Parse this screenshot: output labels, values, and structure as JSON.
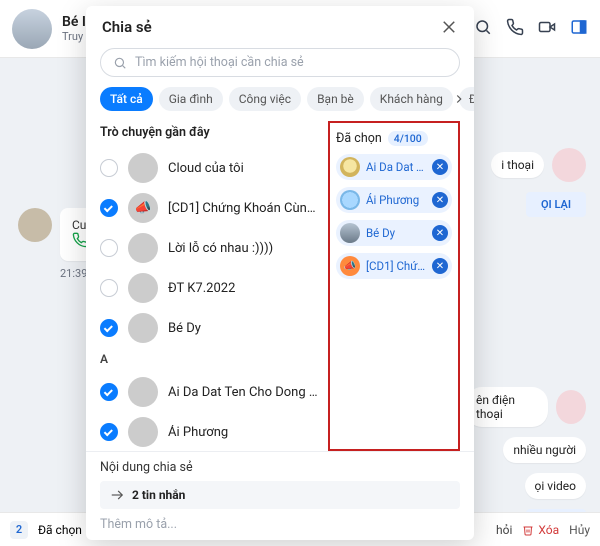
{
  "bg": {
    "title": "Bé I",
    "subtitle": "Truy",
    "bubble_label": "Cuộ",
    "bubble_time": "21:39",
    "right_chips": [
      "i thoại",
      "ên điện thoại",
      "nhiều người",
      "ọi video"
    ],
    "right_btn": "ỌI LẠI",
    "footer_count": "2",
    "footer_selected": "Đã chọn",
    "footer_more": "Thêm mô tả...",
    "footer_btn1": "hỏi",
    "footer_del": "Xóa",
    "footer_cancel": "Hủy"
  },
  "modal": {
    "title": "Chia sẻ",
    "search_placeholder": "Tìm kiếm hội thoại cần chia sẻ",
    "tabs": [
      "Tất cả",
      "Gia đình",
      "Công việc",
      "Bạn bè",
      "Khách hàng",
      "Đồng nghiệ..."
    ],
    "recent_label": "Trò chuyện gần đây",
    "alpha_header": "A",
    "recent": [
      {
        "name": "Cloud của tôi",
        "selected": false,
        "avatar": "av-cloud"
      },
      {
        "name": "[CD1] Chứng Khoán Cùng NMT",
        "selected": true,
        "avatar": "av-mega"
      },
      {
        "name": "Lời lỗ có nhau :))))",
        "selected": false,
        "avatar": "av-duo"
      },
      {
        "name": "ĐT K7.2022",
        "selected": false,
        "avatar": "av-orange"
      },
      {
        "name": "Bé Dy",
        "selected": true,
        "avatar": "av-man"
      }
    ],
    "alpha": [
      {
        "name": "Ai Da Dat Ten Cho Dong Song ...",
        "selected": true,
        "avatar": "av-gold"
      },
      {
        "name": "Ái Phương",
        "selected": true,
        "avatar": "av-blue"
      }
    ],
    "selected_label": "Đã chọn",
    "selected_count": "4/100",
    "chips": [
      {
        "label": "Ai Da Dat T...",
        "av": "gold"
      },
      {
        "label": "Ái Phương",
        "av": "bl"
      },
      {
        "label": "Bé Dy",
        "av": "man"
      },
      {
        "label": "[CD1] Chứn...",
        "av": "mega"
      }
    ],
    "content_label": "Nội dung chia sẻ",
    "attachment": "2 tin nhắn",
    "attachment_label_prefix": "2",
    "desc_placeholder": "Thêm mô tả..."
  }
}
